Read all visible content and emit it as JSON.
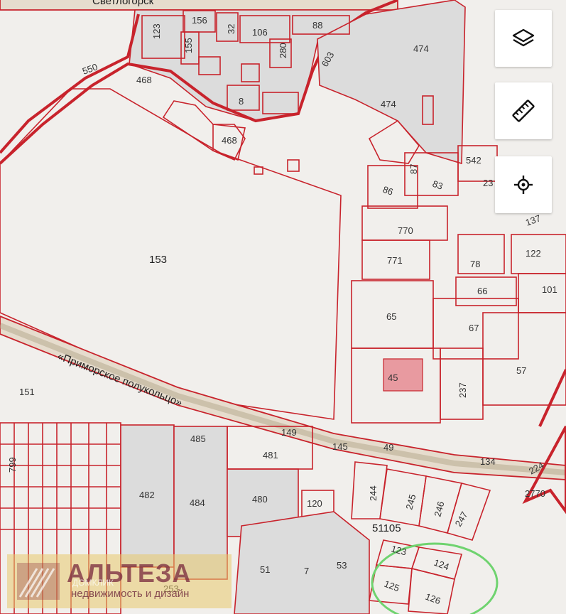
{
  "map": {
    "labels": {
      "top_road": "Светлогорск",
      "road_name": "«Приморское полукольцо»",
      "block_number": "51105",
      "p156": "156",
      "p123": "123",
      "p32": "32",
      "p106": "106",
      "p88": "88",
      "p155": "155",
      "p280": "280",
      "p603": "603",
      "p474a": "474",
      "p550": "550",
      "p468a": "468",
      "p8": "8",
      "p474b": "474",
      "p468b": "468",
      "p542": "542",
      "p87": "87",
      "p23": "23",
      "p83": "83",
      "p86": "86",
      "p137": "137",
      "p770": "770",
      "p122": "122",
      "p771": "771",
      "p78": "78",
      "p66": "66",
      "p101": "101",
      "p153": "153",
      "p65": "65",
      "p67": "67",
      "p57": "57",
      "p45": "45",
      "p237": "237",
      "p151": "151",
      "p149": "149",
      "p485": "485",
      "p481": "481",
      "p145": "145",
      "p49": "49",
      "p134": "134",
      "p224": "224",
      "p799": "799",
      "p244": "244",
      "p245": "245",
      "p246": "246",
      "p247": "247",
      "p2770": "2770",
      "p482": "482",
      "p484": "484",
      "p480": "480",
      "p120": "120",
      "p123b": "123",
      "p124": "124",
      "p125": "125",
      "p126": "126",
      "p51": "51",
      "p7": "7",
      "p53": "53",
      "p253": "253"
    }
  },
  "controls": {
    "layers_icon": "layers-icon",
    "ruler_icon": "ruler-icon",
    "locate_icon": "crosshair-icon"
  },
  "watermark": {
    "title": "АЛЬТЕЗА",
    "subtitle": "недвижимость и дизайн",
    "partner": "ДОМКЛИК"
  },
  "colors": {
    "parcel_border": "#c8232c",
    "background": "#f1efec",
    "highlight": "#6fd36f"
  }
}
